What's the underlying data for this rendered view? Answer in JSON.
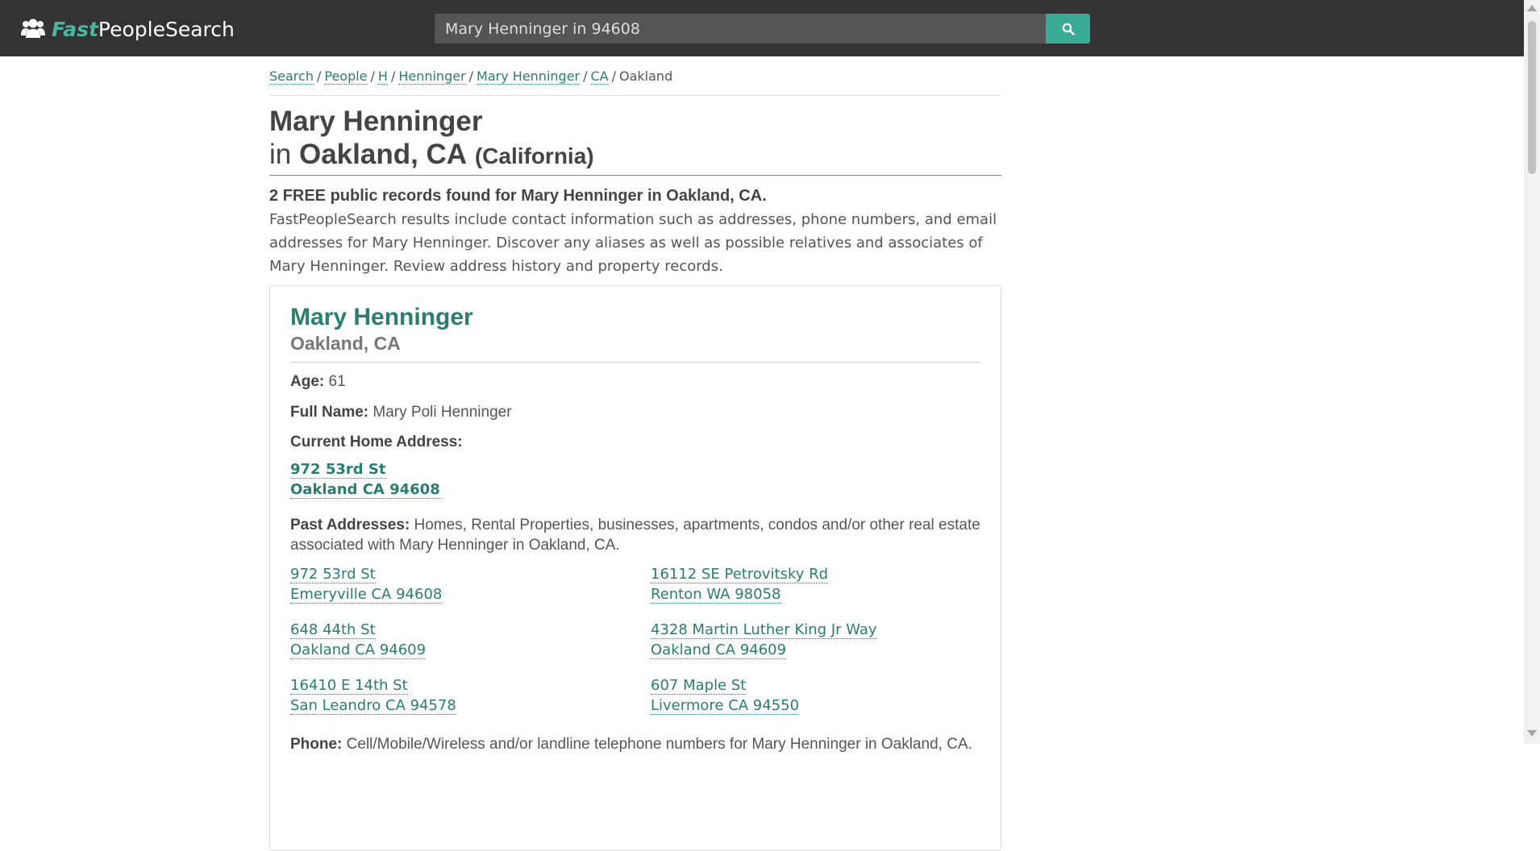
{
  "header": {
    "logo_fast": "Fast",
    "logo_rest": "PeopleSearch",
    "search_value": "Mary Henninger in 94608",
    "search_button_icon": "search-icon"
  },
  "breadcrumb": [
    {
      "label": "Search"
    },
    {
      "label": "People"
    },
    {
      "label": "H"
    },
    {
      "label": "Henninger"
    },
    {
      "label": "Mary Henninger"
    },
    {
      "label": "CA"
    },
    {
      "label": "Oakland"
    }
  ],
  "title": {
    "name": "Mary Henninger",
    "in": "in",
    "location": "Oakland, CA",
    "state": "(California)"
  },
  "summary": {
    "records_count": "2 FREE public records found for Mary Henninger in Oakland, CA.",
    "intro": "FastPeopleSearch results include contact information such as addresses, phone numbers, and email addresses for Mary Henninger. Discover any aliases as well as possible relatives and associates of Mary Henninger. Review address history and property records."
  },
  "record": {
    "name": "Mary Henninger",
    "location": "Oakland, CA",
    "age_label": "Age:",
    "age": "61",
    "full_name_label": "Full Name:",
    "full_name": "Mary Poli Henninger",
    "current_address_label": "Current Home Address:",
    "current_address_line1": "972 53rd St",
    "current_address_line2": "Oakland CA 94608",
    "past_label": "Past Addresses:",
    "past_desc": "Homes, Rental Properties, businesses, apartments, condos and/or other real estate associated with Mary Henninger in Oakland, CA.",
    "past_addresses": [
      {
        "line1": "972 53rd St",
        "line2": "Emeryville CA 94608"
      },
      {
        "line1": "16112 SE Petrovitsky Rd",
        "line2": "Renton WA 98058"
      },
      {
        "line1": "648 44th St",
        "line2": "Oakland CA 94609"
      },
      {
        "line1": "4328 Martin Luther King Jr Way",
        "line2": "Oakland CA 94609"
      },
      {
        "line1": "16410 E 14th St",
        "line2": "San Leandro CA 94578"
      },
      {
        "line1": "607 Maple St",
        "line2": "Livermore CA 94550"
      }
    ],
    "phone_label": "Phone:",
    "phone_desc": "Cell/Mobile/Wireless and/or landline telephone numbers for Mary Henninger in Oakland, CA."
  },
  "colors": {
    "topbar": "#333333",
    "accent": "#3aab94",
    "link": "#2a7d6f"
  }
}
